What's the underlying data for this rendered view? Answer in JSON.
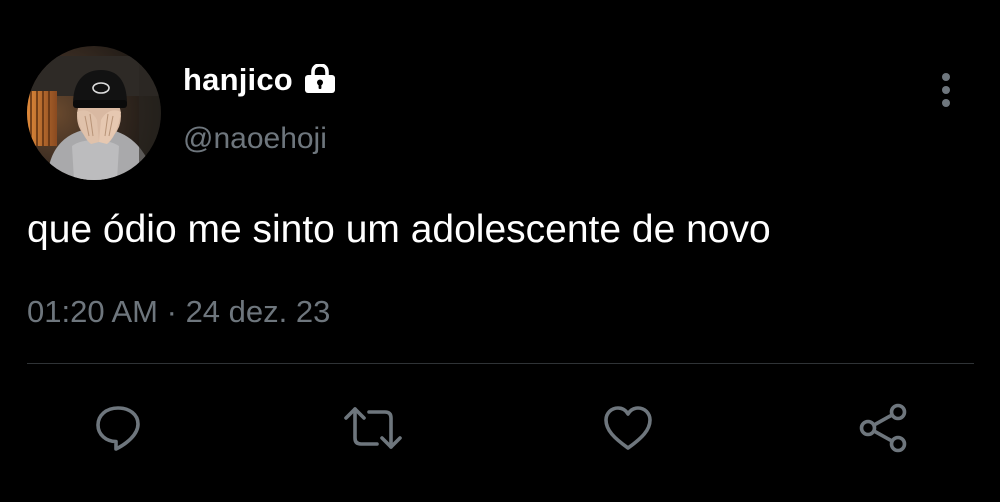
{
  "colors": {
    "background": "#000000",
    "text_primary": "#ffffff",
    "text_secondary": "#6e767d",
    "icon": "#6e767d",
    "divider": "#2f3336"
  },
  "author": {
    "display_name": "hanjico",
    "handle": "@naoehoji",
    "protected_icon": "lock-icon",
    "avatar_icon": "avatar-photo"
  },
  "tweet": {
    "text": "que ódio me sinto um adolescente de novo",
    "time": "01:20 AM",
    "separator": "·",
    "date": "24 dez. 23"
  },
  "actions": [
    {
      "name": "reply",
      "icon": "reply-icon"
    },
    {
      "name": "retweet",
      "icon": "retweet-icon"
    },
    {
      "name": "like",
      "icon": "heart-icon"
    },
    {
      "name": "share",
      "icon": "share-icon"
    }
  ],
  "menu": {
    "icon": "more-vertical-icon"
  }
}
